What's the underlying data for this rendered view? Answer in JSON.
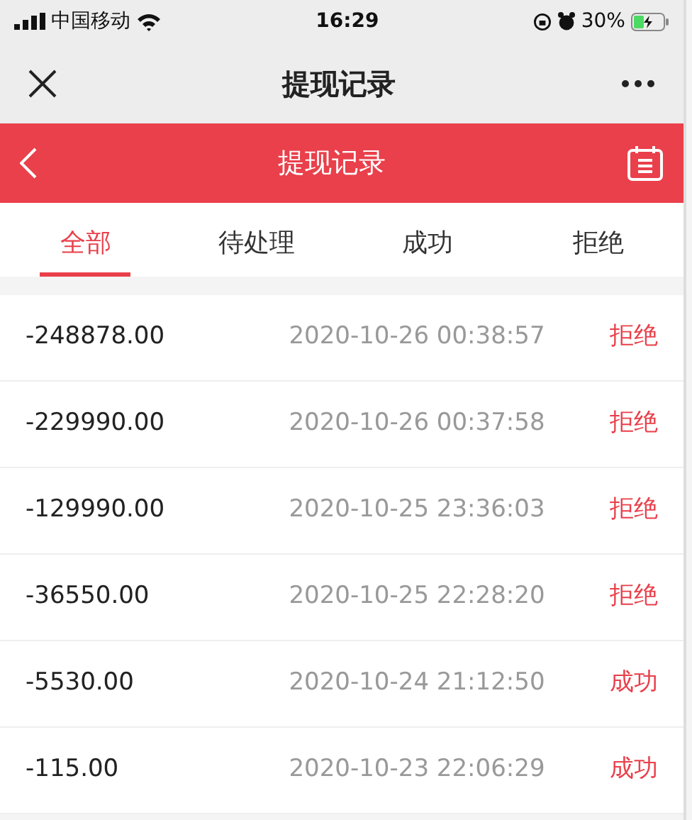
{
  "status_bar": {
    "carrier": "中国移动",
    "time": "16:29",
    "battery": "30%"
  },
  "nav_bar": {
    "title": "提现记录"
  },
  "header": {
    "title": "提现记录"
  },
  "tabs": [
    {
      "label": "全部",
      "selected": true
    },
    {
      "label": "待处理",
      "selected": false
    },
    {
      "label": "成功",
      "selected": false
    },
    {
      "label": "拒绝",
      "selected": false
    }
  ],
  "records": [
    {
      "amount": "-248878.00",
      "time": "2020-10-26 00:38:57",
      "status": "拒绝"
    },
    {
      "amount": "-229990.00",
      "time": "2020-10-26 00:37:58",
      "status": "拒绝"
    },
    {
      "amount": "-129990.00",
      "time": "2020-10-25 23:36:03",
      "status": "拒绝"
    },
    {
      "amount": "-36550.00",
      "time": "2020-10-25 22:28:20",
      "status": "拒绝"
    },
    {
      "amount": "-5530.00",
      "time": "2020-10-24 21:12:50",
      "status": "成功"
    },
    {
      "amount": "-115.00",
      "time": "2020-10-23 22:06:29",
      "status": "成功"
    }
  ]
}
